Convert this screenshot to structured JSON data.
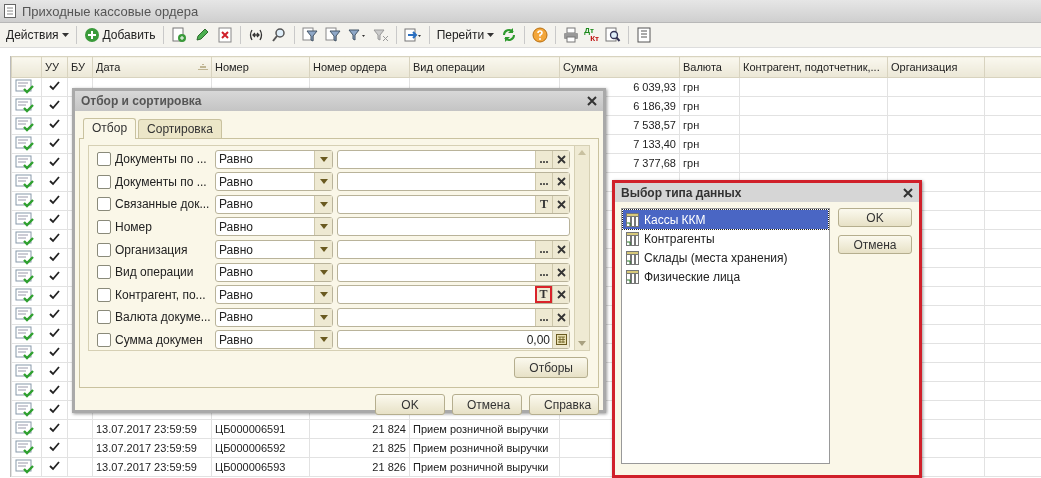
{
  "window": {
    "title": "Приходные кассовые ордера"
  },
  "toolbar": [
    {
      "kind": "menu",
      "label": "Действия"
    },
    {
      "kind": "separator"
    },
    {
      "kind": "add",
      "label": "Добавить"
    },
    {
      "kind": "separator"
    },
    {
      "kind": "copy"
    },
    {
      "kind": "pencil"
    },
    {
      "kind": "delete"
    },
    {
      "kind": "separator"
    },
    {
      "kind": "link"
    },
    {
      "kind": "find"
    },
    {
      "kind": "separator"
    },
    {
      "kind": "filter"
    },
    {
      "kind": "filter"
    },
    {
      "kind": "filtermenu"
    },
    {
      "kind": "filteroff"
    },
    {
      "kind": "separator"
    },
    {
      "kind": "movemenu"
    },
    {
      "kind": "separator"
    },
    {
      "kind": "menu",
      "label": "Перейти"
    },
    {
      "kind": "refresh"
    },
    {
      "kind": "separator"
    },
    {
      "kind": "help"
    },
    {
      "kind": "separator"
    },
    {
      "kind": "print"
    },
    {
      "kind": "dtkt",
      "top": "Дт",
      "bottom": "Кт"
    },
    {
      "kind": "preview"
    },
    {
      "kind": "separator"
    },
    {
      "kind": "list"
    }
  ],
  "table": {
    "columns": [
      {
        "label": "УУ",
        "sorted": false
      },
      {
        "label": "БУ",
        "sorted": false
      },
      {
        "label": "Дата",
        "sorted": true
      },
      {
        "label": "Номер",
        "sorted": false
      },
      {
        "label": "Номер ордера",
        "sorted": false
      },
      {
        "label": "Вид операции",
        "sorted": false
      },
      {
        "label": "Сумма",
        "sorted": false
      },
      {
        "label": "Валюта",
        "sorted": false
      },
      {
        "label": "Контрагент, подотчетник,...",
        "sorted": false
      },
      {
        "label": "Организация",
        "sorted": false
      }
    ],
    "rows": [
      {
        "posted": true,
        "uu": true,
        "bu": false,
        "sum": "6 039,93",
        "currency": "грн"
      },
      {
        "posted": true,
        "uu": true,
        "bu": false,
        "sum": "6 186,39",
        "currency": "грн"
      },
      {
        "posted": true,
        "uu": true,
        "bu": false,
        "sum": "7 538,57",
        "currency": "грн"
      },
      {
        "posted": true,
        "uu": true,
        "bu": false,
        "sum": "7 133,40",
        "currency": "грн"
      },
      {
        "posted": true,
        "uu": true,
        "bu": false,
        "sum": "7 377,68",
        "currency": "грн"
      },
      {
        "posted": true,
        "uu": true,
        "bu": false
      },
      {
        "posted": true,
        "uu": true,
        "bu": false
      },
      {
        "posted": true,
        "uu": true,
        "bu": false
      },
      {
        "posted": true,
        "uu": true,
        "bu": false
      },
      {
        "posted": true,
        "uu": true,
        "bu": false
      },
      {
        "posted": true,
        "uu": true,
        "bu": false
      },
      {
        "posted": true,
        "uu": true,
        "bu": false
      },
      {
        "posted": true,
        "uu": true,
        "bu": false
      },
      {
        "posted": true,
        "uu": true,
        "bu": false
      },
      {
        "posted": true,
        "uu": true,
        "bu": false
      },
      {
        "posted": true,
        "uu": true,
        "bu": false
      },
      {
        "posted": true,
        "uu": true,
        "bu": false
      },
      {
        "posted": true,
        "uu": true,
        "bu": false
      },
      {
        "posted": true,
        "uu": true,
        "bu": false,
        "date": "13.07.2017 23:59:59",
        "number": "ЦБ000006591",
        "order": "21 824",
        "operation": "Прием розничной выручки"
      },
      {
        "posted": true,
        "uu": true,
        "bu": false,
        "date": "13.07.2017 23:59:59",
        "number": "ЦБ000006592",
        "order": "21 825",
        "operation": "Прием розничной выручки"
      },
      {
        "posted": true,
        "uu": true,
        "bu": false,
        "date": "13.07.2017 23:59:59",
        "number": "ЦБ000006593",
        "order": "21 826",
        "operation": "Прием розничной выручки"
      }
    ]
  },
  "filter_dialog": {
    "title": "Отбор и сортировка",
    "tabs": [
      {
        "label": "Отбор",
        "selected": true
      },
      {
        "label": "Сортировка",
        "selected": false
      }
    ],
    "filters": [
      {
        "label": "Документы по ...",
        "checked": false,
        "condition": "Равно",
        "kind": "choice",
        "button_label": "...",
        "highlighted": false
      },
      {
        "label": "Документы по ...",
        "checked": false,
        "condition": "Равно",
        "kind": "choice",
        "button_label": "...",
        "highlighted": false
      },
      {
        "label": "Связанные док...",
        "checked": false,
        "condition": "Равно",
        "kind": "choice",
        "button_label": "T",
        "highlighted": false
      },
      {
        "label": "Номер",
        "checked": false,
        "condition": "Равно",
        "kind": "plain"
      },
      {
        "label": "Организация",
        "checked": false,
        "condition": "Равно",
        "kind": "choice",
        "button_label": "...",
        "highlighted": false
      },
      {
        "label": "Вид операции",
        "checked": false,
        "condition": "Равно",
        "kind": "choice",
        "button_label": "...",
        "highlighted": false
      },
      {
        "label": "Контрагент, по...",
        "checked": false,
        "condition": "Равно",
        "kind": "choice",
        "button_label": "T",
        "highlighted": true
      },
      {
        "label": "Валюта докуме...",
        "checked": false,
        "condition": "Равно",
        "kind": "choice",
        "button_label": "...",
        "highlighted": false
      },
      {
        "label": "Сумма докумен",
        "checked": false,
        "condition": "Равно",
        "kind": "number",
        "value": "0,00"
      }
    ],
    "side_button": "Отборы",
    "buttons": [
      "OK",
      "Отмена",
      "Справка"
    ]
  },
  "type_dialog": {
    "title": "Выбор типа данных",
    "items": [
      {
        "label": "Кассы ККМ",
        "selected": true
      },
      {
        "label": "Контрагенты",
        "selected": false
      },
      {
        "label": "Склады (места хранения)",
        "selected": false
      },
      {
        "label": "Физические лица",
        "selected": false
      }
    ],
    "buttons": [
      "OK",
      "Отмена"
    ]
  }
}
